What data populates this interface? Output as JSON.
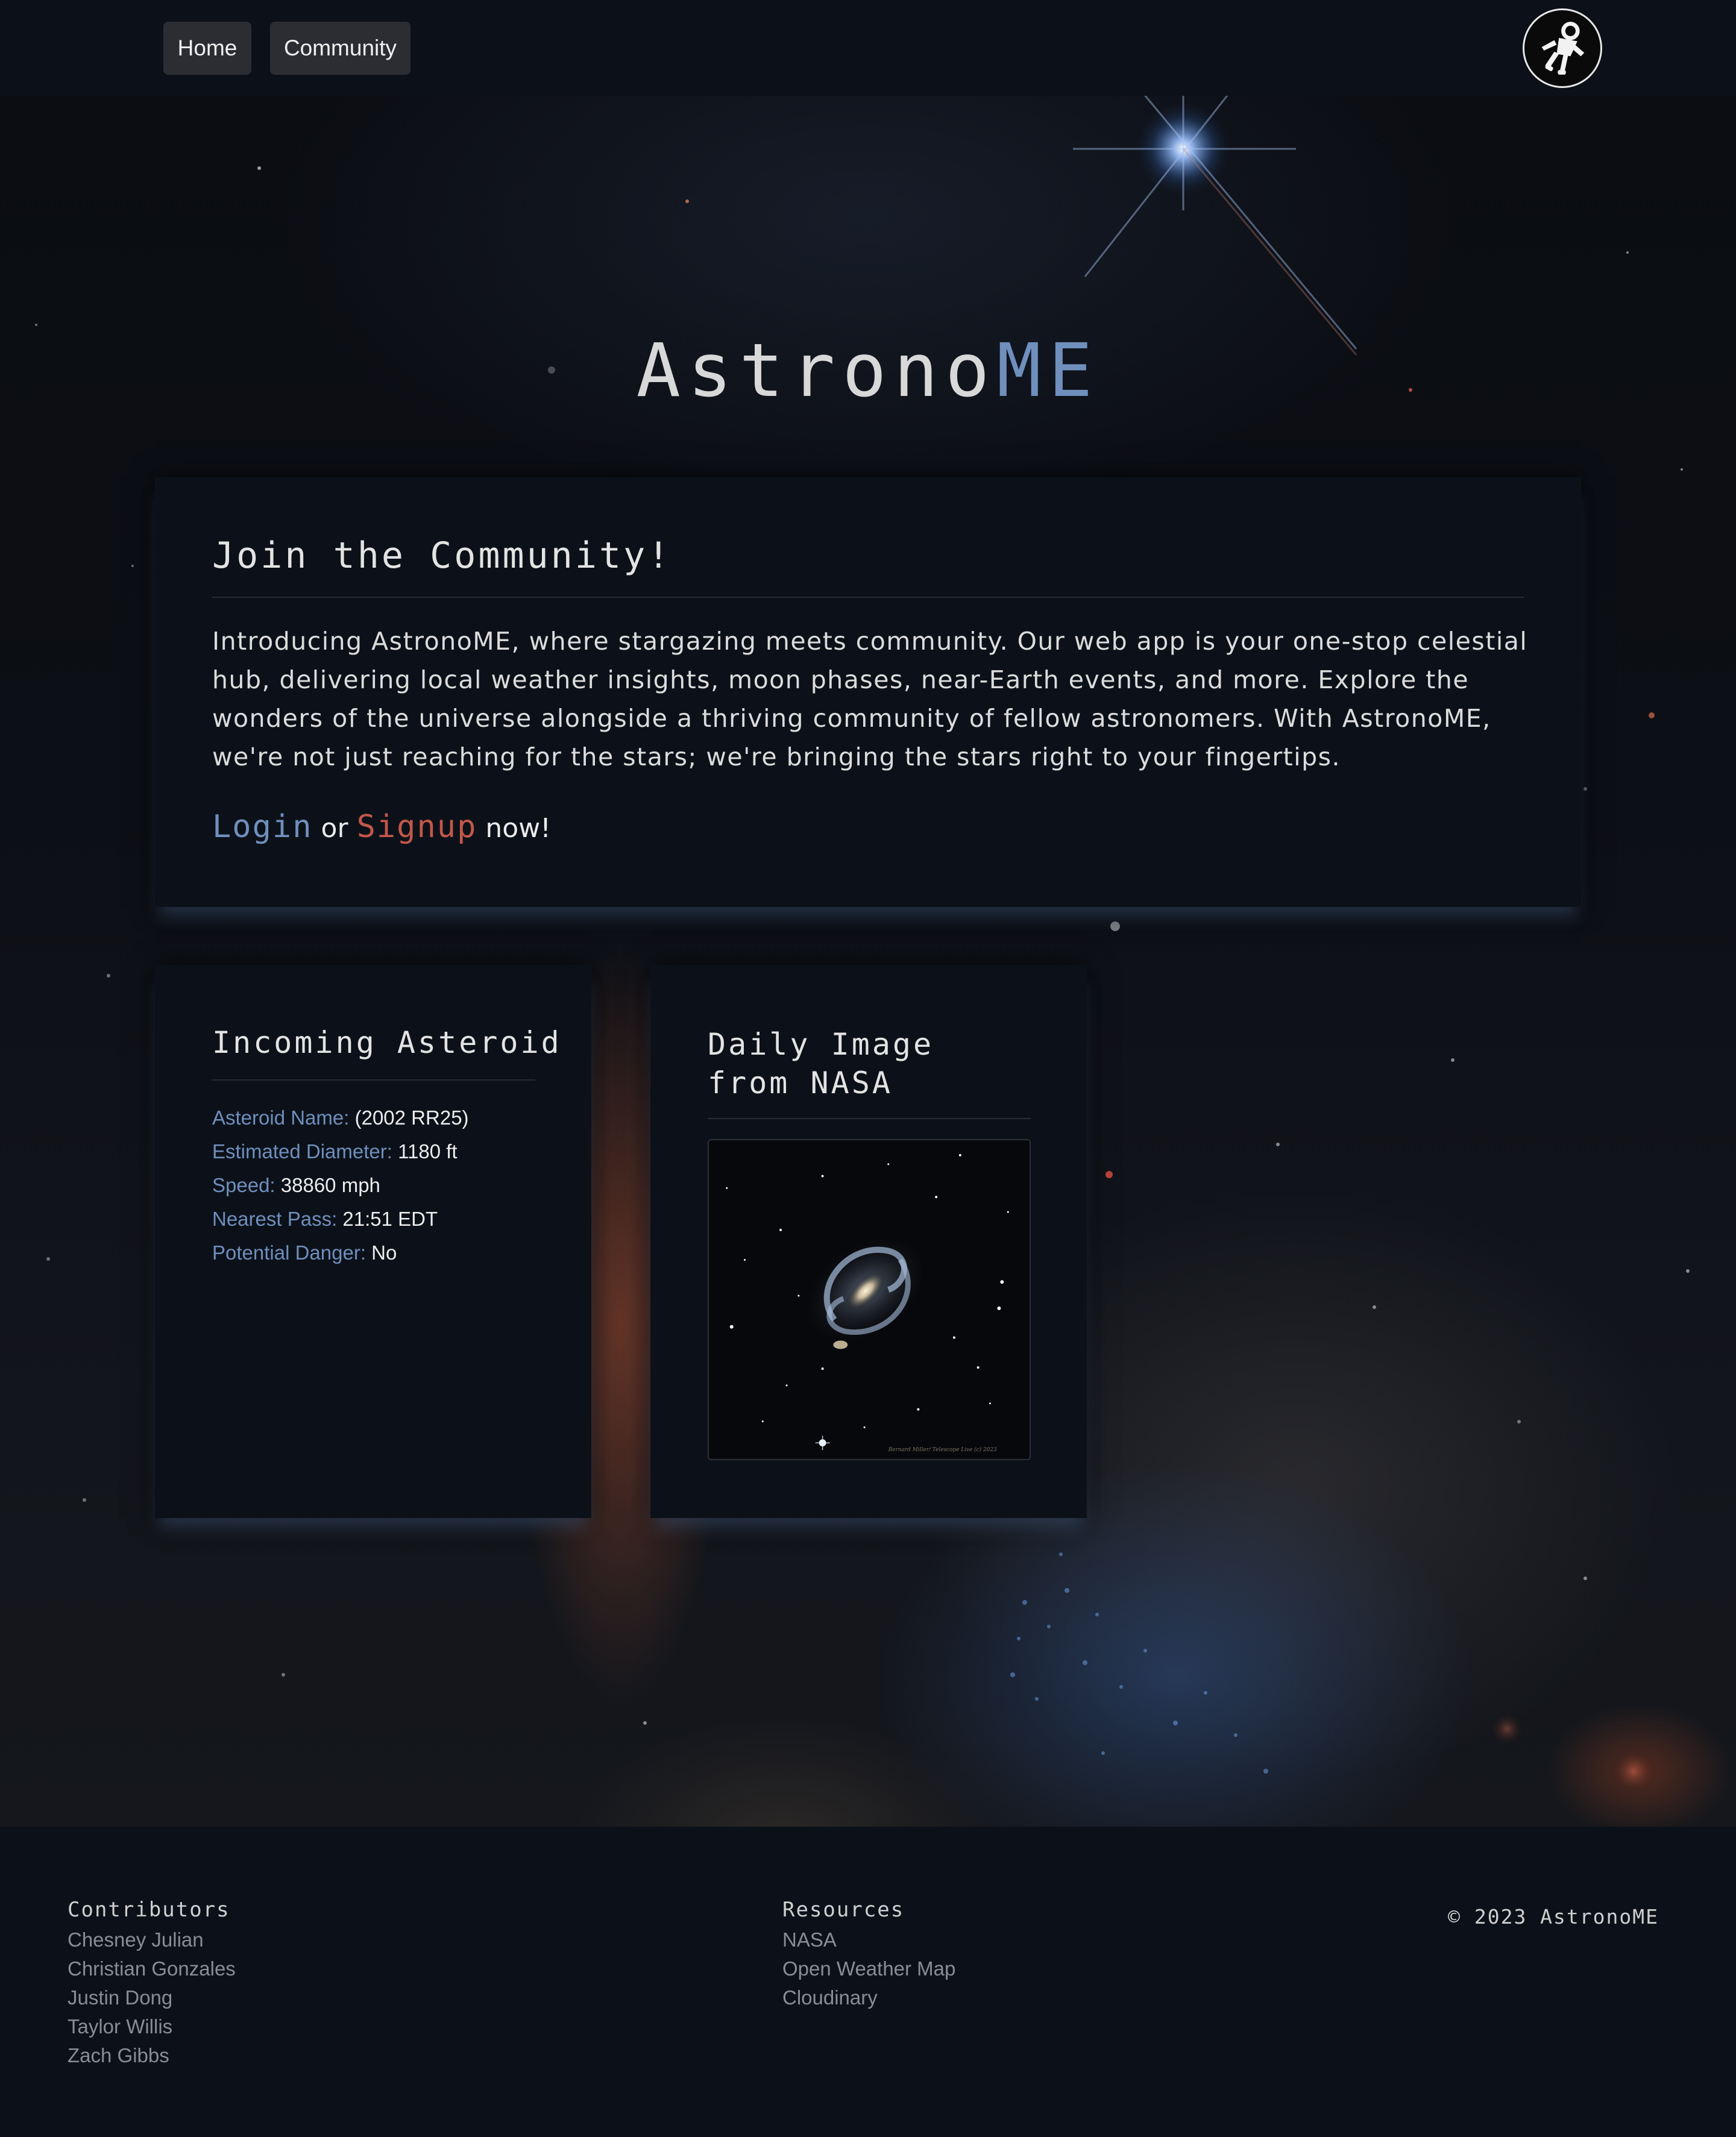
{
  "nav": {
    "home_label": "Home",
    "community_label": "Community",
    "logo_icon": "astronaut-icon"
  },
  "hero": {
    "title_main": "Astrono",
    "title_accent": "ME"
  },
  "join": {
    "heading": "Join the Community!",
    "body": "Introducing AstronoME, where stargazing meets community. Our web app is your one-stop celestial hub, delivering local weather insights, moon phases, near-Earth events, and more. Explore the wonders of the universe alongside a thriving community of fellow astronomers. With AstronoME, we're not just reaching for the stars; we're bringing the stars right to your fingertips.",
    "login_label": "Login",
    "or_text": "or",
    "signup_label": "Signup",
    "now_text": "now!"
  },
  "asteroid": {
    "heading": "Incoming Asteroid",
    "rows": [
      {
        "label": "Asteroid Name:",
        "value": "(2002 RR25)"
      },
      {
        "label": "Estimated Diameter:",
        "value": "1180 ft"
      },
      {
        "label": "Speed:",
        "value": "38860 mph"
      },
      {
        "label": "Nearest Pass:",
        "value": "21:51 EDT"
      },
      {
        "label": "Potential Danger:",
        "value": "No"
      }
    ]
  },
  "nasa": {
    "heading": "Daily Image from NASA",
    "image_credit": "Bernard Miller/ Telescope Live (c) 2023"
  },
  "footer": {
    "contributors_heading": "Contributors",
    "contributors": [
      "Chesney Julian",
      "Christian Gonzales",
      "Justin Dong",
      "Taylor Willis",
      "Zach Gibbs"
    ],
    "resources_heading": "Resources",
    "resources": [
      "NASA",
      "Open Weather Map",
      "Cloudinary"
    ],
    "copyright": "© 2023 AstronoME"
  },
  "colors": {
    "accent_blue": "#6f8fbd",
    "accent_red": "#c2574a",
    "card_bg": "#0c1119"
  }
}
